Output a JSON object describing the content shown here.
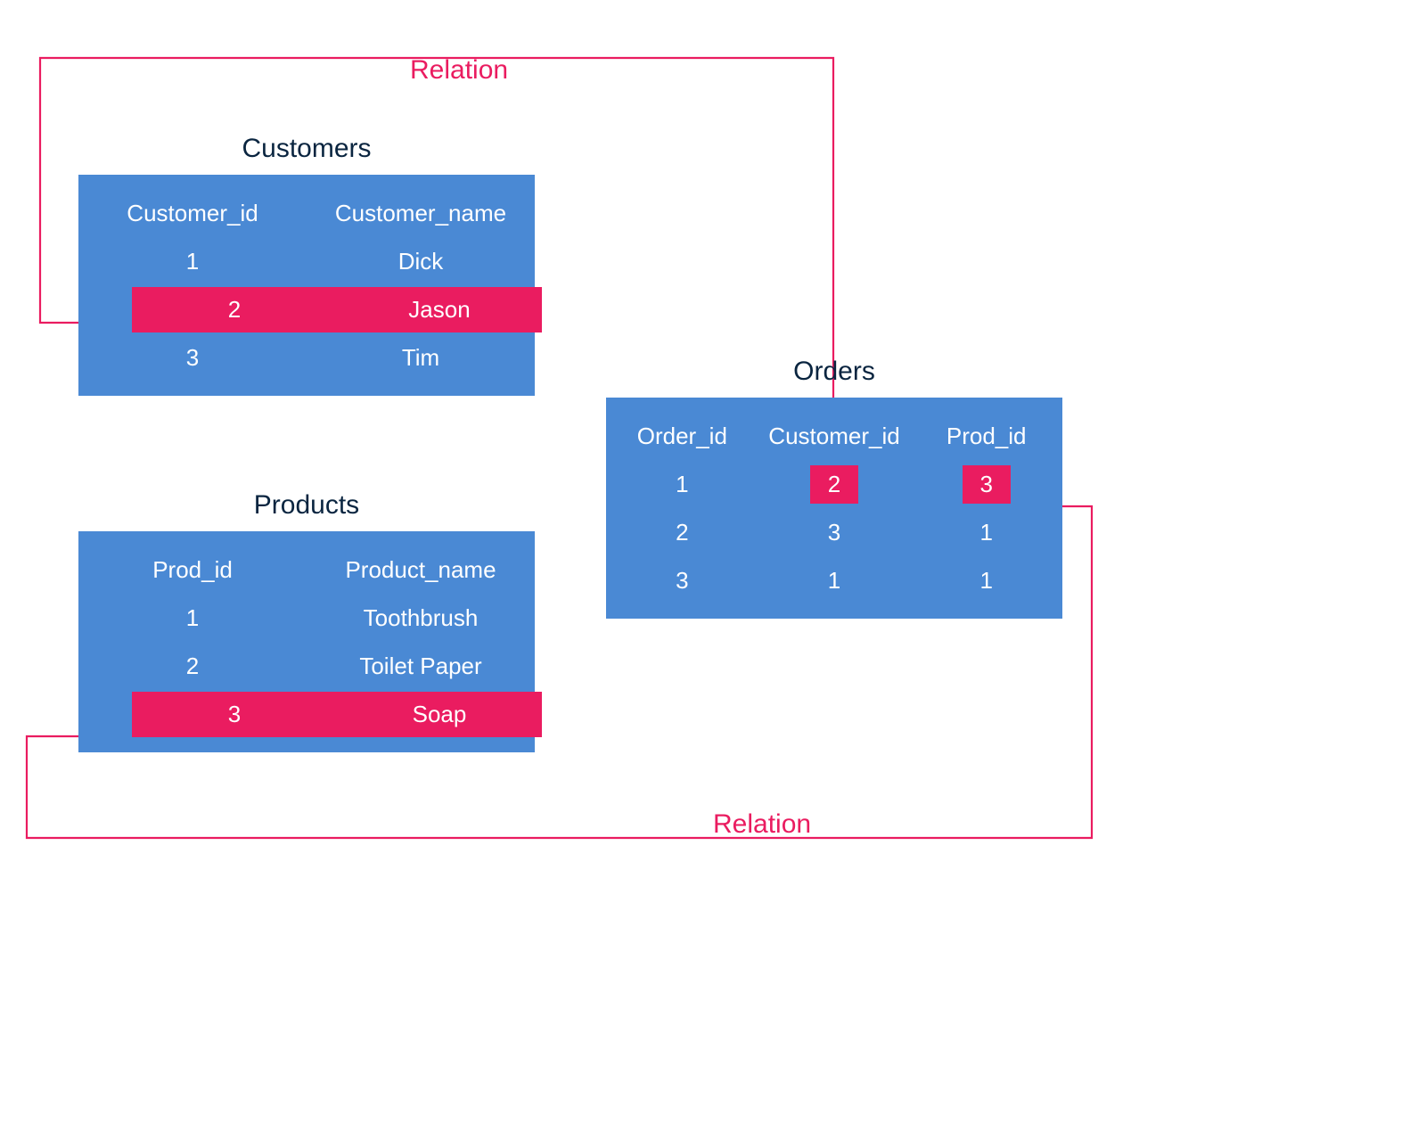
{
  "relation_label_top": "Relation",
  "relation_label_bottom": "Relation",
  "colors": {
    "table_bg": "#4a89d4",
    "highlight": "#ea1c60",
    "title": "#0a2540"
  },
  "customers": {
    "title": "Customers",
    "columns": [
      "Customer_id",
      "Customer_name"
    ],
    "rows": [
      {
        "id": "1",
        "name": "Dick",
        "highlight": false
      },
      {
        "id": "2",
        "name": "Jason",
        "highlight": true
      },
      {
        "id": "3",
        "name": "Tim",
        "highlight": false
      }
    ]
  },
  "products": {
    "title": "Products",
    "columns": [
      "Prod_id",
      "Product_name"
    ],
    "rows": [
      {
        "id": "1",
        "name": "Toothbrush",
        "highlight": false
      },
      {
        "id": "2",
        "name": "Toilet Paper",
        "highlight": false
      },
      {
        "id": "3",
        "name": "Soap",
        "highlight": true
      }
    ]
  },
  "orders": {
    "title": "Orders",
    "columns": [
      "Order_id",
      "Customer_id",
      "Prod_id"
    ],
    "rows": [
      {
        "order_id": "1",
        "customer_id": "2",
        "prod_id": "3",
        "hl_customer": true,
        "hl_prod": true
      },
      {
        "order_id": "2",
        "customer_id": "3",
        "prod_id": "1",
        "hl_customer": false,
        "hl_prod": false
      },
      {
        "order_id": "3",
        "customer_id": "1",
        "prod_id": "1",
        "hl_customer": false,
        "hl_prod": false
      }
    ]
  }
}
